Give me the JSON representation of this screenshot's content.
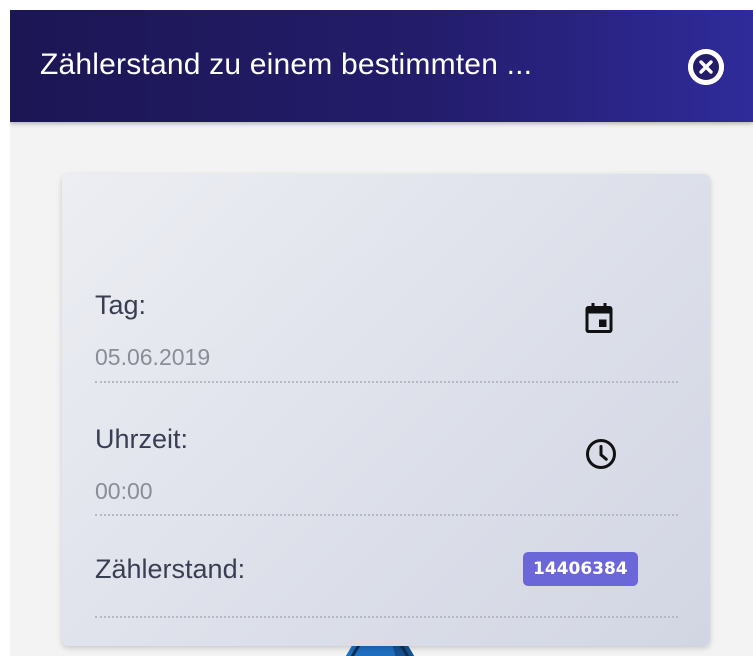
{
  "dialog": {
    "title": "Zählerstand zu einem bestimmten ...",
    "close_icon": "close-circle-icon"
  },
  "form": {
    "date": {
      "label": "Tag:",
      "value": "05.06.2019",
      "icon": "calendar-icon"
    },
    "time": {
      "label": "Uhrzeit:",
      "value": "00:00",
      "icon": "clock-icon"
    },
    "meter": {
      "label": "Zählerstand:",
      "value": "14406384"
    }
  },
  "colors": {
    "header_start": "#1c1654",
    "header_end": "#2f2b9a",
    "badge": "#6c67d8",
    "background": "#f3f3f3"
  }
}
